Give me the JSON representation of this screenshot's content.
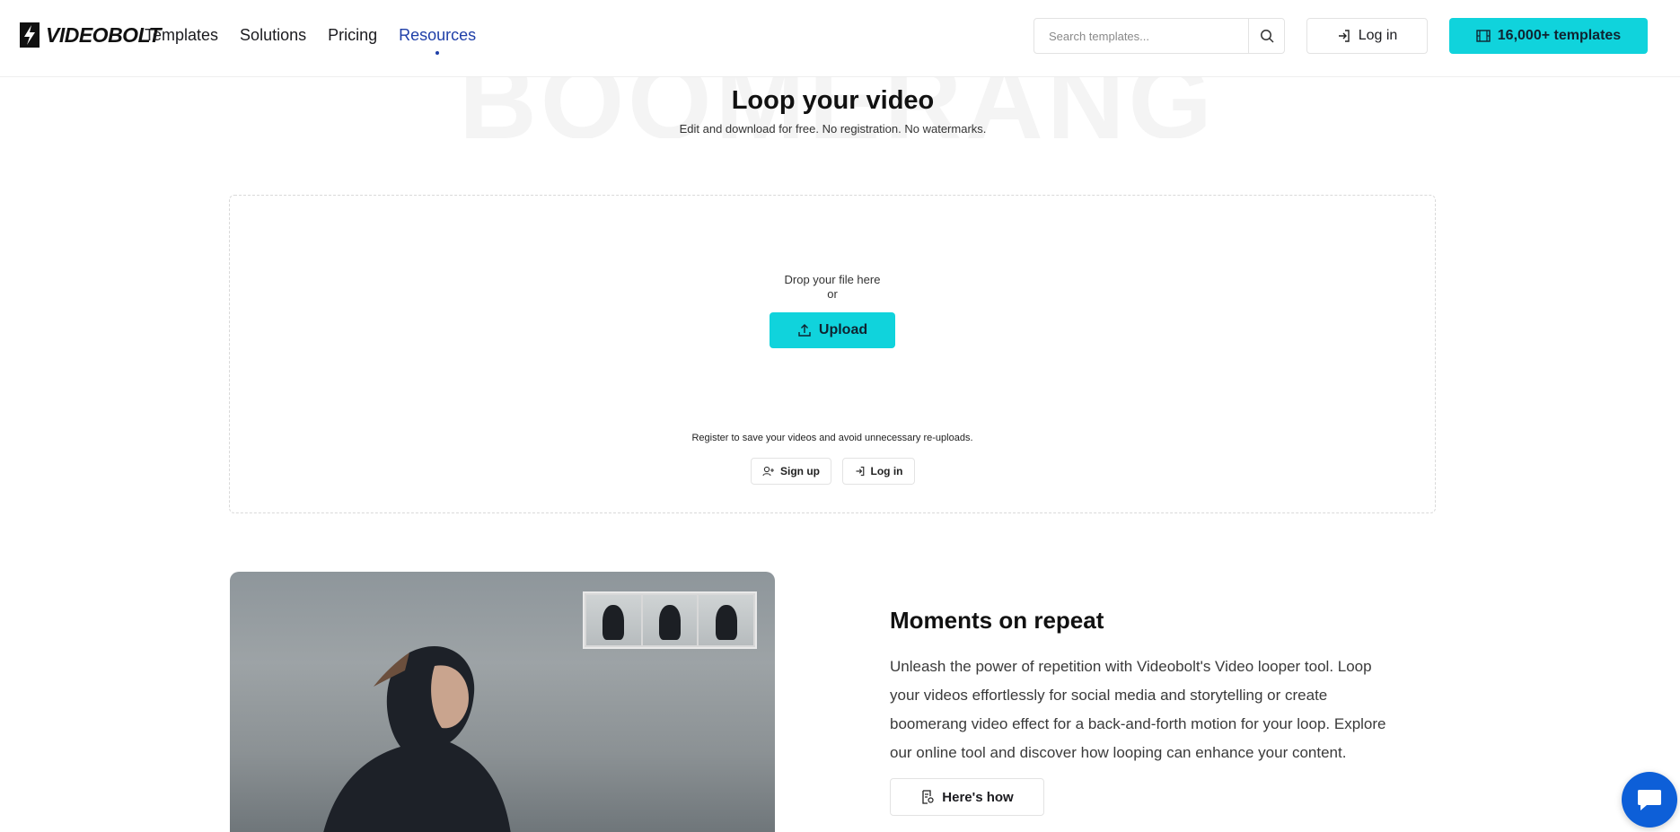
{
  "header": {
    "logo_text": "VIDEOBOLT",
    "nav": [
      {
        "label": "Templates"
      },
      {
        "label": "Solutions"
      },
      {
        "label": "Pricing"
      },
      {
        "label": "Resources"
      }
    ],
    "search": {
      "placeholder": "Search templates..."
    },
    "login_label": "Log in",
    "templates_label": "16,000+ templates"
  },
  "hero": {
    "bg_word": "BOOMERANG",
    "title": "Loop your video",
    "subtitle": "Edit and download for free. No registration. No watermarks."
  },
  "dropzone": {
    "drop_text": "Drop your file here",
    "or_text": "or",
    "upload_label": "Upload",
    "register_text": "Register to save your videos and avoid unnecessary re-uploads.",
    "signup_label": "Sign up",
    "login_label": "Log in"
  },
  "feature": {
    "title": "Moments on repeat",
    "text": "Unleash the power of repetition with Videobolt's Video looper tool. Loop your videos effortlessly for social media and storytelling or create boomerang video effect for a back-and-forth motion for your loop. Explore our online tool and discover how looping can enhance your content.",
    "button_label": "Here's how"
  },
  "colors": {
    "accent": "#10d3dc",
    "active_nav": "#1f3fa8",
    "chat": "#0d5fd8"
  }
}
